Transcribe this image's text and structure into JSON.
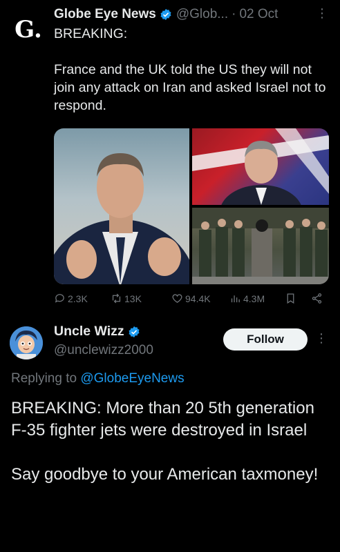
{
  "tweet1": {
    "author_name": "Globe Eye News",
    "handle": "@Glob...",
    "separator": "·",
    "date": "02 Oct",
    "avatar_letter": "G.",
    "text_line1": "BREAKING:",
    "text_body": "France and the UK told the US they will not join any attack on Iran and asked Israel not to respond.",
    "actions": {
      "replies": "2.3K",
      "reposts": "13K",
      "likes": "94.4K",
      "views": "4.3M"
    }
  },
  "tweet2": {
    "author_name": "Uncle Wizz",
    "handle": "@unclewizz2000",
    "follow_label": "Follow",
    "replying_prefix": "Replying to",
    "replying_to": "@GlobeEyeNews",
    "text_para1": "BREAKING: More than 20 5th generation F-35 fighter jets were destroyed in Israel",
    "text_para2": "Say goodbye to your American taxmoney!"
  },
  "colors": {
    "background": "#000000",
    "primary_text": "#e7e9ea",
    "secondary_text": "#71767b",
    "accent": "#1d9bf0",
    "follow_button_bg": "#eff3f4"
  }
}
